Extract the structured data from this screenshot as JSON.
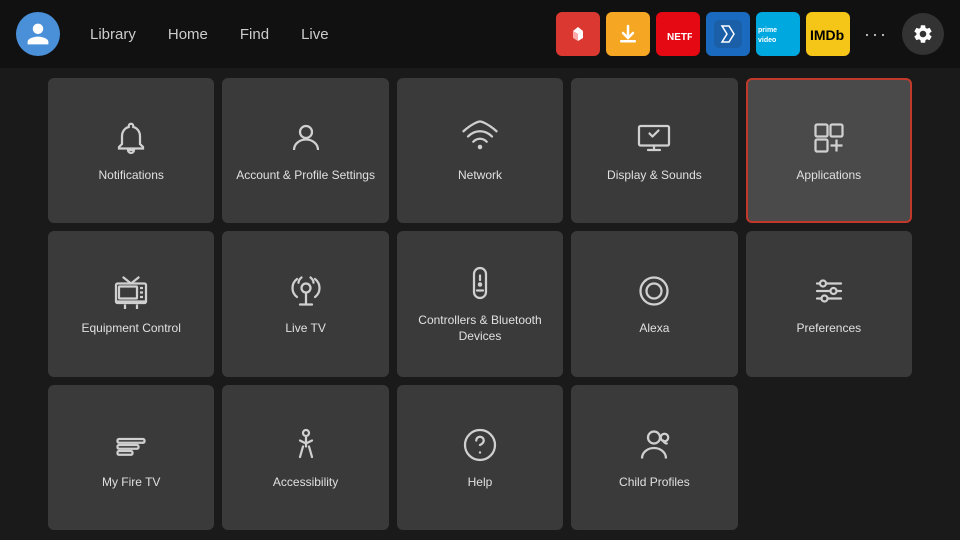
{
  "nav": {
    "links": [
      "Library",
      "Home",
      "Find",
      "Live"
    ],
    "more_label": "···",
    "apps": [
      {
        "name": "ExpressVPN",
        "class": "expressvpn",
        "label": "ExpressVPN"
      },
      {
        "name": "Downloader",
        "class": "downloader",
        "label": "↓"
      },
      {
        "name": "Netflix",
        "class": "netflix",
        "label": "NETFLIX"
      },
      {
        "name": "Fractured",
        "class": "fractured",
        "label": "F"
      },
      {
        "name": "Prime Video",
        "class": "primevideo",
        "label": "prime video"
      },
      {
        "name": "IMDb",
        "class": "imdb",
        "label": "IMDb"
      }
    ]
  },
  "grid": {
    "items": [
      {
        "id": "notifications",
        "label": "Notifications",
        "icon": "bell",
        "active": false
      },
      {
        "id": "account-profile",
        "label": "Account & Profile Settings",
        "icon": "person",
        "active": false
      },
      {
        "id": "network",
        "label": "Network",
        "icon": "wifi",
        "active": false
      },
      {
        "id": "display-sounds",
        "label": "Display & Sounds",
        "icon": "display",
        "active": false
      },
      {
        "id": "applications",
        "label": "Applications",
        "icon": "apps",
        "active": true
      },
      {
        "id": "equipment-control",
        "label": "Equipment Control",
        "icon": "tv",
        "active": false
      },
      {
        "id": "live-tv",
        "label": "Live TV",
        "icon": "antenna",
        "active": false
      },
      {
        "id": "controllers-bluetooth",
        "label": "Controllers & Bluetooth Devices",
        "icon": "remote",
        "active": false
      },
      {
        "id": "alexa",
        "label": "Alexa",
        "icon": "alexa",
        "active": false
      },
      {
        "id": "preferences",
        "label": "Preferences",
        "icon": "sliders",
        "active": false
      },
      {
        "id": "my-fire-tv",
        "label": "My Fire TV",
        "icon": "firetv",
        "active": false
      },
      {
        "id": "accessibility",
        "label": "Accessibility",
        "icon": "accessibility",
        "active": false
      },
      {
        "id": "help",
        "label": "Help",
        "icon": "help",
        "active": false
      },
      {
        "id": "child-profiles",
        "label": "Child Profiles",
        "icon": "child",
        "active": false
      }
    ]
  }
}
